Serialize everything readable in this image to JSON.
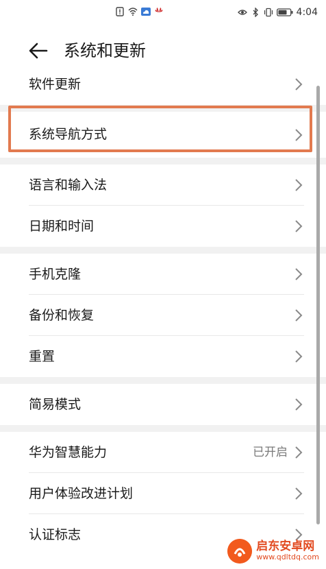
{
  "status_bar": {
    "time": "4:04"
  },
  "header": {
    "title": "系统和更新"
  },
  "menu": {
    "items": [
      {
        "label": "软件更新"
      },
      {
        "label": "系统导航方式"
      },
      {
        "label": "语言和输入法"
      },
      {
        "label": "日期和时间"
      },
      {
        "label": "手机克隆"
      },
      {
        "label": "备份和恢复"
      },
      {
        "label": "重置"
      },
      {
        "label": "简易模式"
      },
      {
        "label": "华为智慧能力",
        "value": "已开启"
      },
      {
        "label": "用户体验改进计划"
      },
      {
        "label": "认证标志"
      }
    ]
  },
  "highlight_color": "#e27a4f",
  "watermark": {
    "name": "启东安卓网",
    "url": "www.qdltdq.com"
  }
}
